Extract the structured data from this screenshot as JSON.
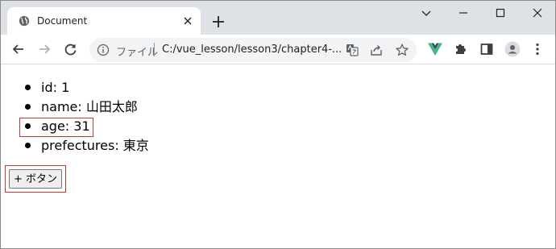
{
  "browser": {
    "tab": {
      "title": "Document",
      "favicon": "globe-icon"
    },
    "address_bar": {
      "scheme_label": "ファイル",
      "url": "C:/vue_lesson/lesson3/chapter4-..."
    },
    "icons": {
      "back": "back-arrow-icon",
      "forward": "forward-arrow-icon",
      "reload": "reload-icon",
      "translate": "translate-icon",
      "share": "share-icon",
      "bookmark": "star-icon",
      "vue_devtools": "vue-icon",
      "extensions": "puzzle-icon",
      "side_panel": "side-panel-icon",
      "profile": "profile-icon"
    },
    "accent_color": "#41b883"
  },
  "page": {
    "items": [
      {
        "text": "id: 1"
      },
      {
        "text": "name: 山田太郎"
      },
      {
        "text": "age: 31"
      },
      {
        "text": "prefectures: 東京"
      }
    ],
    "button_label": "+ ボタン",
    "highlight_color": "#c0393b"
  }
}
